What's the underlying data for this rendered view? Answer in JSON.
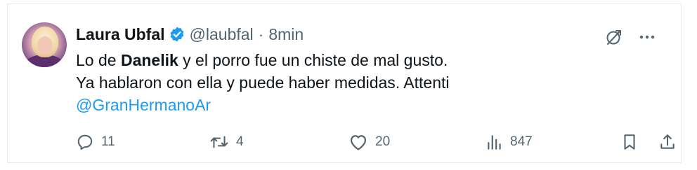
{
  "tweet": {
    "author_name": "Laura Ubfal",
    "handle": "@laubfal",
    "separator": "·",
    "time": "8min",
    "line1_pre": "Lo de ",
    "line1_bold": "Danelik",
    "line1_post": " y el porro fue un chiste de mal gusto.",
    "line2": "Ya hablaron con ella y puede haber medidas. Attenti",
    "mention": "@GranHermanoAr"
  },
  "stats": {
    "replies": "11",
    "retweets": "4",
    "likes": "20",
    "views": "847"
  },
  "icons": {
    "verified": "verified-badge-icon",
    "grok": "grok-icon",
    "more": "more-icon",
    "reply": "reply-icon",
    "retweet": "retweet-icon",
    "like": "heart-icon",
    "views": "views-icon",
    "bookmark": "bookmark-icon",
    "share": "share-icon"
  },
  "colors": {
    "text": "#0f1419",
    "secondary": "#536471",
    "link": "#1d9bf0",
    "verified": "#1d9bf0"
  }
}
